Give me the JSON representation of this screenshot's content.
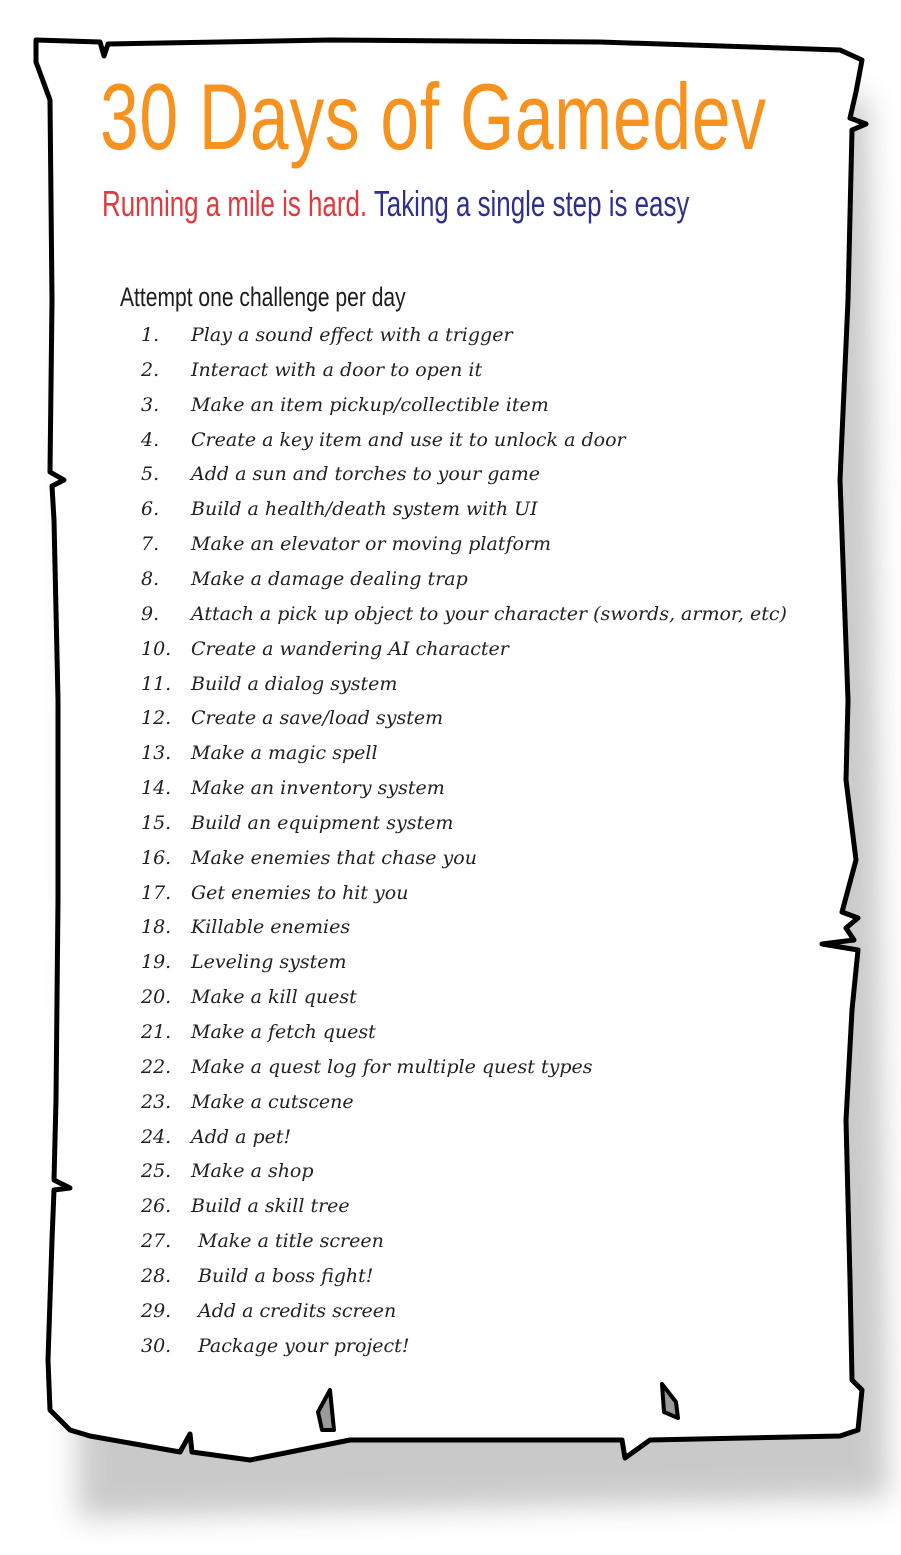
{
  "title": "30 Days of Gamedev",
  "subtitle": {
    "part1": "Running a mile is hard.",
    "part2": "Taking a single step is easy"
  },
  "instruction": "Attempt one challenge per day",
  "colors": {
    "title": "#f7921e",
    "subtitle_red": "#e0393e",
    "subtitle_blue": "#2f2f8f",
    "ink": "#222222",
    "paper": "#ffffff",
    "border": "#000000"
  },
  "challenges": [
    {
      "num": "1.",
      "text": "Play a sound effect with a trigger"
    },
    {
      "num": "2.",
      "text": "Interact with a door to open it"
    },
    {
      "num": "3.",
      "text": "Make an item pickup/collectible item"
    },
    {
      "num": "4.",
      "text": "Create a key item and use it to unlock a door"
    },
    {
      "num": "5.",
      "text": "Add a sun and torches to your game"
    },
    {
      "num": "6.",
      "text": "Build a health/death system with UI"
    },
    {
      "num": "7.",
      "text": "Make an elevator or moving platform"
    },
    {
      "num": "8.",
      "text": "Make a damage dealing trap"
    },
    {
      "num": "9.",
      "text": "Attach a pick up object to your character (swords, armor, etc)"
    },
    {
      "num": "10.",
      "text": "Create a wandering AI character"
    },
    {
      "num": "11.",
      "text": "Build a dialog system"
    },
    {
      "num": "12.",
      "text": "Create a save/load system"
    },
    {
      "num": "13.",
      "text": "Make a magic spell"
    },
    {
      "num": "14.",
      "text": "Make an inventory system"
    },
    {
      "num": "15.",
      "text": "Build an equipment system"
    },
    {
      "num": "16.",
      "text": "Make enemies that chase you"
    },
    {
      "num": "17.",
      "text": "Get enemies to hit you"
    },
    {
      "num": "18.",
      "text": "Killable enemies"
    },
    {
      "num": "19.",
      "text": "Leveling system"
    },
    {
      "num": "20.",
      "text": "Make a kill quest"
    },
    {
      "num": "21.",
      "text": "Make a fetch quest"
    },
    {
      "num": "22.",
      "text": "Make a quest log for multiple quest types"
    },
    {
      "num": "23.",
      "text": "Make a cutscene"
    },
    {
      "num": "24.",
      "text": "Add a pet!"
    },
    {
      "num": "25.",
      "text": "Make a shop"
    },
    {
      "num": "26.",
      "text": "Build a skill tree"
    },
    {
      "num": "27.",
      "text": "Make a title screen"
    },
    {
      "num": "28.",
      "text": "Build a boss fight!"
    },
    {
      "num": "29.",
      "text": "Add a credits screen"
    },
    {
      "num": "30.",
      "text": "Package your project!"
    }
  ]
}
